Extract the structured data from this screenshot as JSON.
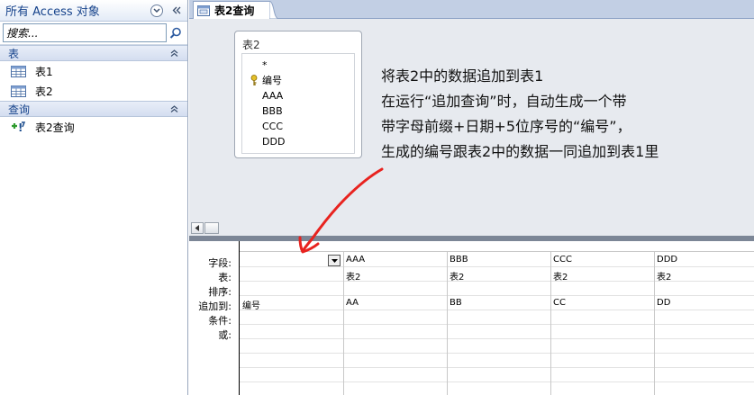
{
  "nav": {
    "title": "所有 Access 对象",
    "search_placeholder": "搜索...",
    "groups": [
      {
        "label": "表",
        "items": [
          "表1",
          "表2"
        ]
      },
      {
        "label": "查询",
        "items": [
          "表2查询"
        ]
      }
    ]
  },
  "tab": {
    "label": "表2查询"
  },
  "table_box": {
    "title": "表2",
    "fields": [
      "*",
      "编号",
      "AAA",
      "BBB",
      "CCC",
      "DDD"
    ]
  },
  "annotation": {
    "lines": [
      "将表2中的数据追加到表1",
      "在运行“追加查询”时，自动生成一个带",
      "带字母前缀+日期+5位序号的“编号”，",
      "生成的编号跟表2中的数据一同追加到表1里"
    ]
  },
  "grid": {
    "row_labels": [
      "字段:",
      "表:",
      "排序:",
      "追加到:",
      "条件:",
      "或:"
    ],
    "columns": [
      {
        "field": "",
        "table": "",
        "append_to": "编号"
      },
      {
        "field": "AAA",
        "table": "表2",
        "append_to": "AA"
      },
      {
        "field": "BBB",
        "table": "表2",
        "append_to": "BB"
      },
      {
        "field": "CCC",
        "table": "表2",
        "append_to": "CC"
      },
      {
        "field": "DDD",
        "table": "表2",
        "append_to": "DD"
      }
    ]
  },
  "colors": {
    "nav_text": "#15428b",
    "arrow": "#e8231f",
    "upper_bg": "#e7eaef",
    "splitter": "#7c8696"
  }
}
